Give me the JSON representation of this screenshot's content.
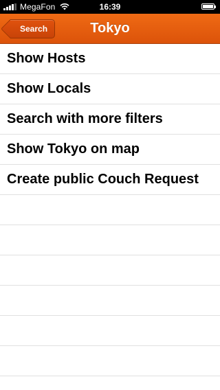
{
  "status_bar": {
    "carrier": "MegaFon",
    "time": "16:39"
  },
  "nav": {
    "back_label": "Search",
    "title": "Tokyo"
  },
  "menu": {
    "items": [
      {
        "label": "Show Hosts"
      },
      {
        "label": "Show Locals"
      },
      {
        "label": "Search with more filters"
      },
      {
        "label": "Show Tokyo on map"
      },
      {
        "label": "Create public Couch Request"
      }
    ]
  },
  "colors": {
    "nav_background": "#e35e10",
    "back_button": "#cf4a0b",
    "separator": "#e0e0e0"
  },
  "icons": [
    "signal-icon",
    "wifi-icon",
    "battery-icon",
    "back-chevron-icon"
  ]
}
